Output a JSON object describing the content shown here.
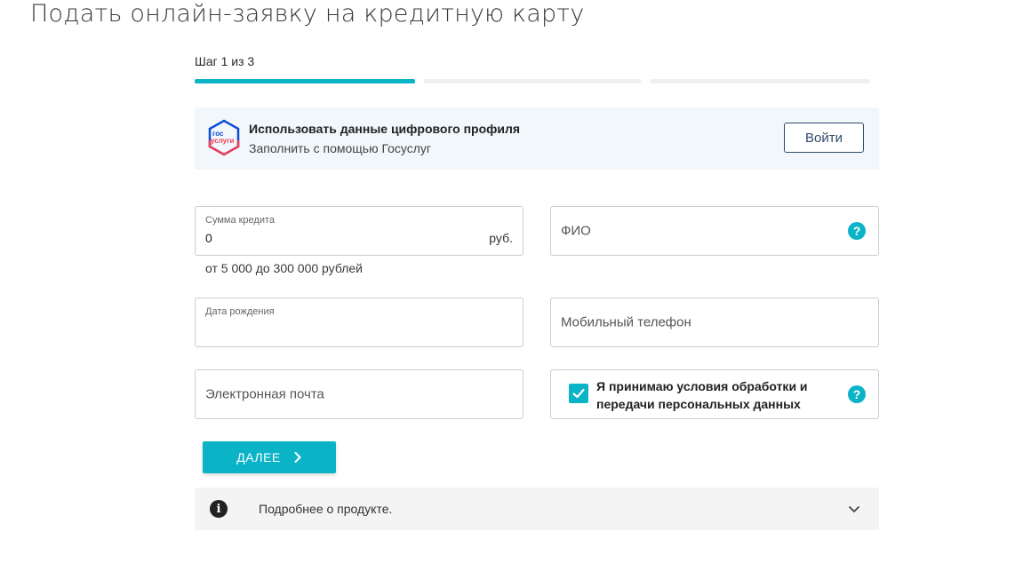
{
  "page": {
    "title": "Подать онлайн-заявку на кредитную карту"
  },
  "stepper": {
    "label": "Шаг 1 из 3",
    "current": 1,
    "total": 3
  },
  "gosuslugi": {
    "logo_text_top": "гос",
    "logo_text_bottom": "услуги",
    "title": "Использовать данные цифрового профиля",
    "subtitle": "Заполнить с помощью Госуслуг",
    "button_label": "Войти"
  },
  "form": {
    "credit_amount": {
      "label": "Сумма кредита",
      "value": "0",
      "suffix": "руб.",
      "hint": "от 5 000 до 300 000 рублей"
    },
    "full_name": {
      "placeholder": "ФИО",
      "help_icon": "question-circle"
    },
    "birth_date": {
      "label": "Дата рождения",
      "value": ""
    },
    "mobile_phone": {
      "placeholder": "Мобильный телефон"
    },
    "email": {
      "placeholder": "Электронная почта"
    },
    "consent": {
      "text": "Я принимаю условия обработки и передачи персональных данных",
      "checked": true,
      "help_icon": "question-circle"
    },
    "next_button": {
      "label": "ДАЛЕЕ",
      "icon": "chevron-right"
    }
  },
  "product_details": {
    "label": "Подробнее о продукте.",
    "icon": "info",
    "expand_icon": "chevron-down"
  },
  "colors": {
    "accent": "#0bb3c7",
    "button_border": "#2f4a6b",
    "panel_bg": "#f1f7fb"
  }
}
